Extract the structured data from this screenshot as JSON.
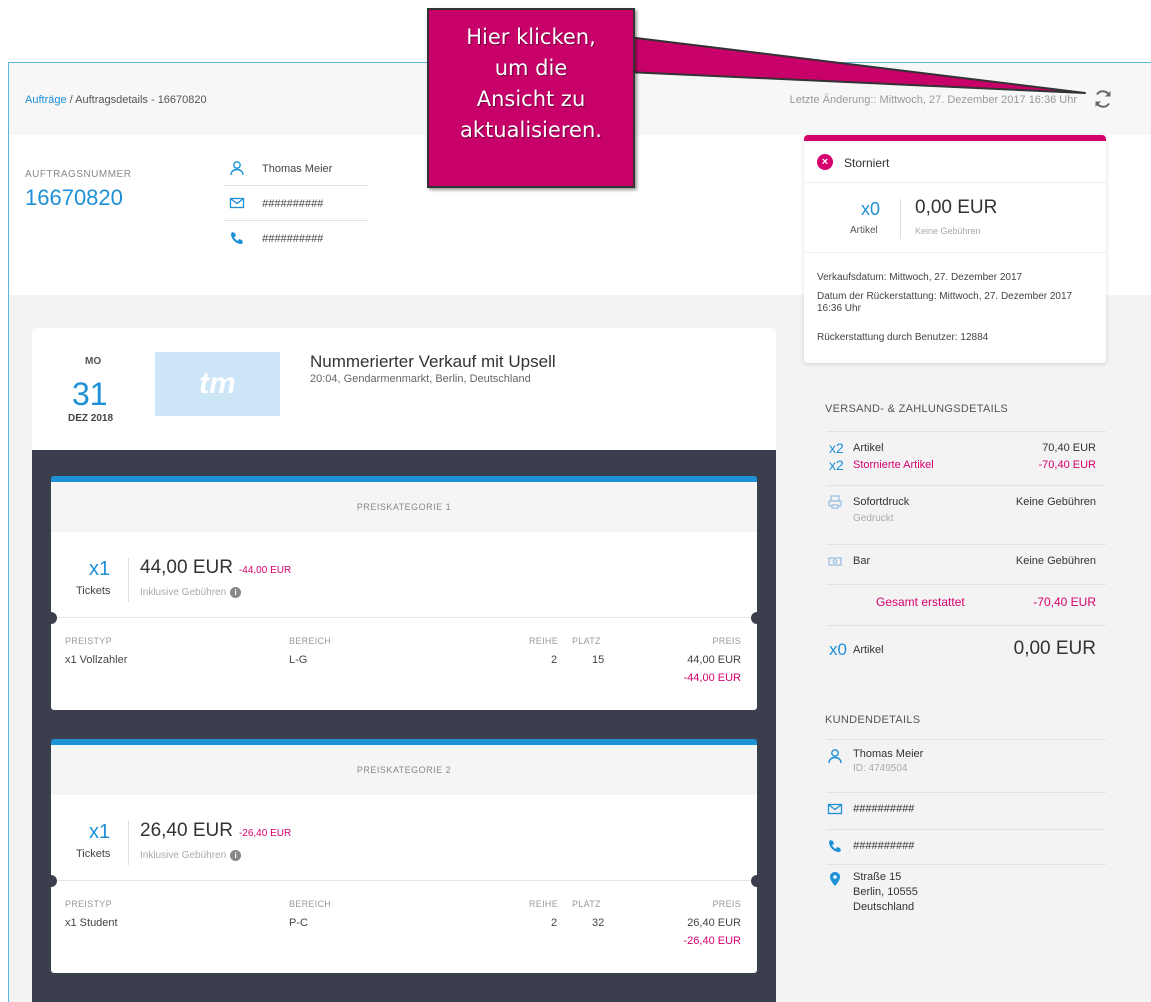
{
  "breadcrumb": {
    "link": "Aufträge",
    "sep": " / ",
    "current": "Auftragsdetails - 16670820"
  },
  "last_change": "Letzte Änderung:: Mittwoch, 27. Dezember 2017 16:36 Uhr",
  "order": {
    "number_label": "AUFTRAGSNUMMER",
    "number": "16670820"
  },
  "contact": {
    "name": "Thomas Meier",
    "email": "##########",
    "phone": "##########"
  },
  "event": {
    "dow": "MO",
    "day": "31",
    "month": "DEZ 2018",
    "logo": "tm",
    "title": "Nummerierter Verkauf mit Upsell",
    "subtitle": "20:04, Gendarmenmarkt, Berlin, Deutschland"
  },
  "tickets": [
    {
      "category": "PREISKATEGORIE 1",
      "qty": "x1",
      "unit": "Tickets",
      "price": "44,00 EUR",
      "neg": "-44,00 EUR",
      "incl": "Inklusive Gebühren",
      "headers": {
        "type": "PREISTYP",
        "area": "BEREICH",
        "row": "REIHE",
        "seat": "PLATZ",
        "price": "PREIS"
      },
      "type": "x1 Vollzahler",
      "area": "L-G",
      "row": "2",
      "seat": "15",
      "line_price": "44,00 EUR",
      "line_neg": "-44,00 EUR"
    },
    {
      "category": "PREISKATEGORIE 2",
      "qty": "x1",
      "unit": "Tickets",
      "price": "26,40 EUR",
      "neg": "-26,40 EUR",
      "incl": "Inklusive Gebühren",
      "headers": {
        "type": "PREISTYP",
        "area": "BEREICH",
        "row": "REIHE",
        "seat": "PLATZ",
        "price": "PREIS"
      },
      "type": "x1 Student",
      "area": "P-C",
      "row": "2",
      "seat": "32",
      "line_price": "26,40 EUR",
      "line_neg": "-26,40 EUR"
    }
  ],
  "status": {
    "label": "Storniert",
    "qty": "x0",
    "unit": "Artikel",
    "price": "0,00 EUR",
    "fees": "Keine Gebühren",
    "sale_date": "Verkaufsdatum: Mittwoch, 27. Dezember 2017",
    "refund_date": "Datum der Rückerstattung: Mittwoch, 27. Dezember 2017 16:36 Uhr",
    "refund_user": "Rückerstattung durch Benutzer: 12884"
  },
  "shipping": {
    "title": "VERSAND- & ZAHLUNGSDETAILS",
    "items_qty": "x2",
    "items_label": "Artikel",
    "items_value": "70,40 EUR",
    "cancel_qty": "x2",
    "cancel_label": "Stornierte Artikel",
    "cancel_value": "-70,40 EUR",
    "print_label": "Sofortdruck",
    "print_sub": "Gedruckt",
    "print_value": "Keine Gebühren",
    "pay_label": "Bar",
    "pay_value": "Keine Gebühren",
    "refund_label": "Gesamt erstattet",
    "refund_value": "-70,40 EUR",
    "total_qty": "x0",
    "total_label": "Artikel",
    "total_value": "0,00 EUR"
  },
  "customer": {
    "title": "KUNDENDETAILS",
    "name": "Thomas Meier",
    "id": "ID: 4749504",
    "email": "##########",
    "phone": "##########",
    "street": "Straße 15",
    "city": "Berlin, 10555",
    "country": "Deutschland"
  },
  "callout": {
    "l1": "Hier klicken,",
    "l2": "um die",
    "l3": "Ansicht zu",
    "l4": "aktualisieren."
  },
  "colors": {
    "accent": "#1e90d6",
    "magenta": "#d6006f",
    "dark": "#3b3f4d"
  }
}
